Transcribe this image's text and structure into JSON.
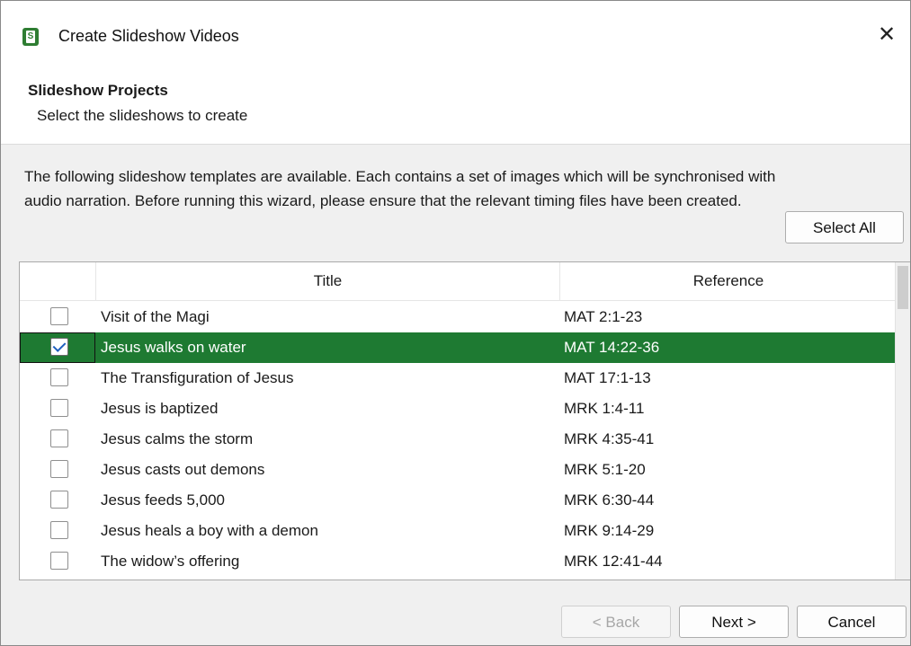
{
  "window": {
    "title": "Create Slideshow Videos",
    "close_glyph": "✕"
  },
  "header": {
    "title": "Slideshow Projects",
    "subtitle": "Select the slideshows to create"
  },
  "description": "The following slideshow templates are available. Each contains a set of images which will be synchronised with audio narration. Before running this wizard, please ensure that the relevant timing files have been created.",
  "buttons": {
    "select_all": "Select All",
    "back": "< Back",
    "next": "Next >",
    "cancel": "Cancel"
  },
  "table": {
    "columns": [
      "",
      "Title",
      "Reference"
    ],
    "rows": [
      {
        "title": "Visit of the Magi",
        "reference": "MAT 2:1-23",
        "checked": false,
        "selected": false
      },
      {
        "title": "Jesus walks on water",
        "reference": "MAT 14:22-36",
        "checked": true,
        "selected": true
      },
      {
        "title": "The Transfiguration of Jesus",
        "reference": "MAT 17:1-13",
        "checked": false,
        "selected": false
      },
      {
        "title": "Jesus is baptized",
        "reference": "MRK 1:4-11",
        "checked": false,
        "selected": false
      },
      {
        "title": "Jesus calms the storm",
        "reference": "MRK 4:35-41",
        "checked": false,
        "selected": false
      },
      {
        "title": "Jesus casts out demons",
        "reference": "MRK 5:1-20",
        "checked": false,
        "selected": false
      },
      {
        "title": "Jesus feeds 5,000",
        "reference": "MRK 6:30-44",
        "checked": false,
        "selected": false
      },
      {
        "title": "Jesus heals a boy with a demon",
        "reference": "MRK 9:14-29",
        "checked": false,
        "selected": false
      },
      {
        "title": "The widow’s offering",
        "reference": "MRK 12:41-44",
        "checked": false,
        "selected": false
      }
    ]
  },
  "colors": {
    "selection": "#1e7a32",
    "app_icon": "#2e7d32"
  }
}
